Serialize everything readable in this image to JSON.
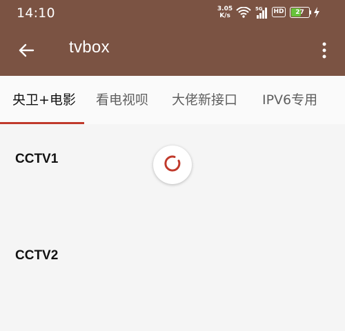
{
  "status_bar": {
    "time": "14:10",
    "network_speed_value": "3.05",
    "network_speed_unit": "K/s",
    "network_type": "5G",
    "hd_label": "HD",
    "battery_level": "27"
  },
  "toolbar": {
    "title": "tvbox"
  },
  "tabs": [
    {
      "label": "央卫+电影"
    },
    {
      "label": "看电视呗"
    },
    {
      "label": "大佬新接口"
    },
    {
      "label": "IPV6专用"
    },
    {
      "label": ""
    }
  ],
  "channels": [
    {
      "name": "CCTV1"
    },
    {
      "name": "CCTV2"
    }
  ],
  "colors": {
    "toolbar": "#7b5343",
    "accent": "#c0392b",
    "battery_fill": "#67c23a"
  }
}
